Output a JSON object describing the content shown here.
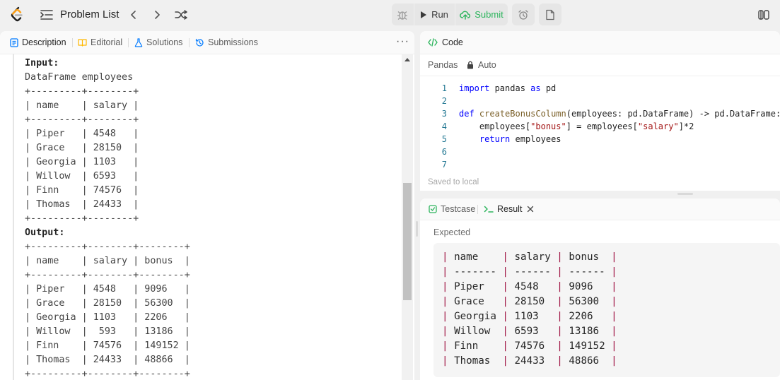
{
  "topbar": {
    "title": "Problem List",
    "run_label": "Run",
    "submit_label": "Submit",
    "accent_green": "#2db55d"
  },
  "left_panel": {
    "tabs": [
      {
        "label": "Description",
        "icon": "description-icon",
        "active": true
      },
      {
        "label": "Editorial",
        "icon": "book-icon",
        "active": false
      },
      {
        "label": "Solutions",
        "icon": "flask-icon",
        "active": false
      },
      {
        "label": "Submissions",
        "icon": "history-icon",
        "active": false
      }
    ],
    "more_label": "···",
    "lines": [
      {
        "text": "Input:",
        "header": true
      },
      {
        "text": "DataFrame employees",
        "header": false
      },
      {
        "text": "+---------+--------+",
        "header": false
      },
      {
        "text": "| name    | salary |",
        "header": false
      },
      {
        "text": "+---------+--------+",
        "header": false
      },
      {
        "text": "| Piper   | 4548   |",
        "header": false
      },
      {
        "text": "| Grace   | 28150  |",
        "header": false
      },
      {
        "text": "| Georgia | 1103   |",
        "header": false
      },
      {
        "text": "| Willow  | 6593   |",
        "header": false
      },
      {
        "text": "| Finn    | 74576  |",
        "header": false
      },
      {
        "text": "| Thomas  | 24433  |",
        "header": false
      },
      {
        "text": "+---------+--------+",
        "header": false
      },
      {
        "text": "Output:",
        "header": true
      },
      {
        "text": "+---------+--------+--------+",
        "header": false
      },
      {
        "text": "| name    | salary | bonus  |",
        "header": false
      },
      {
        "text": "+---------+--------+--------+",
        "header": false
      },
      {
        "text": "| Piper   | 4548   | 9096   |",
        "header": false
      },
      {
        "text": "| Grace   | 28150  | 56300  |",
        "header": false
      },
      {
        "text": "| Georgia | 1103   | 2206   |",
        "header": false
      },
      {
        "text": "| Willow  |  593   | 13186  |",
        "header": false
      },
      {
        "text": "| Finn    | 74576  | 149152 |",
        "header": false
      },
      {
        "text": "| Thomas  | 24433  | 48866  |",
        "header": false
      },
      {
        "text": "+---------+--------+--------+",
        "header": false
      }
    ]
  },
  "code_panel": {
    "title": "Code",
    "language": "Pandas",
    "auto_label": "Auto",
    "saved_status": "Saved to local",
    "line_numbers": [
      "1",
      "2",
      "3",
      "4",
      "5",
      "6",
      "7"
    ]
  },
  "result_panel": {
    "tabs": [
      {
        "label": "Testcase",
        "active": false
      },
      {
        "label": "Result",
        "active": true
      }
    ],
    "expected_label": "Expected",
    "rows": [
      [
        "name",
        "salary",
        "bonus"
      ],
      [
        "-------",
        "------",
        "------"
      ],
      [
        "Piper",
        "4548",
        "9096"
      ],
      [
        "Grace",
        "28150",
        "56300"
      ],
      [
        "Georgia",
        "1103",
        "2206"
      ],
      [
        "Willow",
        "6593",
        "13186"
      ],
      [
        "Finn",
        "74576",
        "149152"
      ],
      [
        "Thomas",
        "24433",
        "48866"
      ]
    ]
  }
}
